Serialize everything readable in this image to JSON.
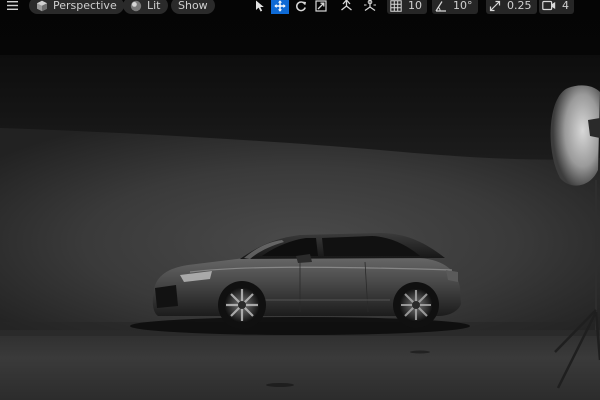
{
  "viewport": {
    "mode_label": "Perspective",
    "lighting_label": "Lit",
    "show_label": "Show",
    "grid_snap_value": "10",
    "rotation_snap_value": "10°",
    "scale_snap_value": "0.25",
    "camera_speed_value": "4"
  },
  "icons": {
    "menu": "hamburger-menu-icon",
    "perspective": "cube-icon",
    "lit": "sphere-icon",
    "select": "cursor-arrow-icon",
    "translate": "move-arrows-icon",
    "rotate": "rotate-icon",
    "scale": "scale-icon",
    "world_local": "world-coordinate-icon",
    "surface_snap": "surface-snap-icon",
    "grid_snap": "grid-icon",
    "rotation_snap": "angle-icon",
    "scale_snap": "scale-arrow-icon",
    "camera_speed": "camera-icon"
  },
  "colors": {
    "active_tool": "#0e6ad6",
    "toolbar_bg": "#2a2a2a",
    "toolbar_text": "#d0d0d0"
  }
}
